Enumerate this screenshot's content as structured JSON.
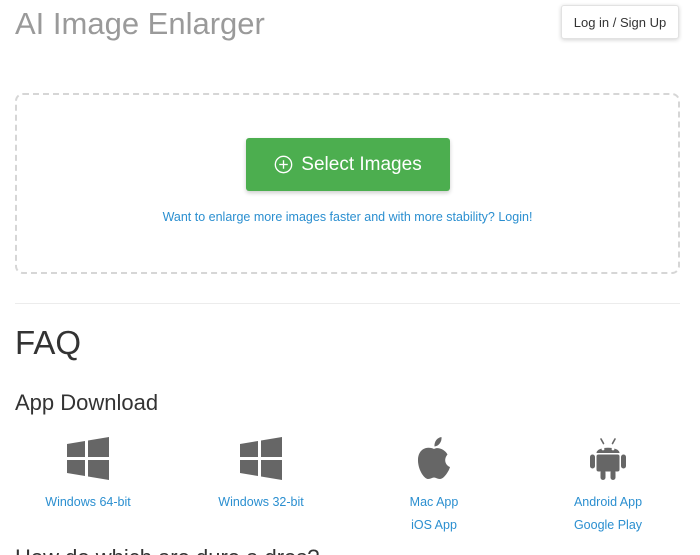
{
  "header": {
    "title": "AI Image Enlarger",
    "login_label": "Log in / Sign Up"
  },
  "upload": {
    "select_label": "Select Images",
    "select_icon": "plus-circle-icon",
    "hint": "Want to enlarge more images faster and with more stability? Login!",
    "button_color": "#4cae4f",
    "link_color": "#2b8fd0"
  },
  "faq": {
    "heading": "FAQ",
    "app_download_heading": "App Download",
    "downloads": [
      {
        "icon": "windows-icon",
        "links": [
          "Windows 64-bit"
        ]
      },
      {
        "icon": "windows-icon",
        "links": [
          "Windows 32-bit"
        ]
      },
      {
        "icon": "apple-icon",
        "links": [
          "Mac App",
          "iOS App"
        ]
      },
      {
        "icon": "android-icon",
        "links": [
          "Android App",
          "Google Play"
        ]
      }
    ],
    "next_heading": "How do which are dure a dres?"
  }
}
